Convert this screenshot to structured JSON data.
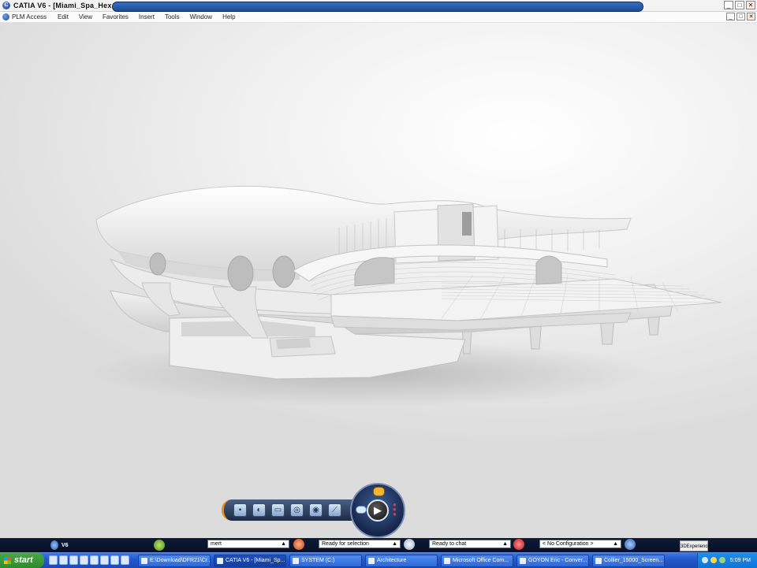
{
  "window": {
    "title": "CATIA V6 - [Miami_Spa_Hex --- IN_WORK]",
    "minimize_glyph": "_",
    "maximize_glyph": "□",
    "close_glyph": "✕"
  },
  "menu": {
    "items": [
      "PLM Access",
      "Edit",
      "View",
      "Favorites",
      "Insert",
      "Tools",
      "Window",
      "Help"
    ]
  },
  "toolbar": {
    "tools": [
      "filter-icon",
      "shading-icon",
      "view-icon",
      "render-icon",
      "camera-icon",
      "measure-icon"
    ]
  },
  "compass": {
    "play_glyph": "▶"
  },
  "status": {
    "v6_label": "V6",
    "command_value": "mert",
    "selection_status": "Ready for selection",
    "chat_status": "Ready to chat",
    "configuration": "< No Configuration >",
    "tray_label": "3DExperience"
  },
  "taskbar": {
    "start_label": "start",
    "tasks": [
      "E:\\Download\\DFR21\\Cr...",
      "CATIA V6 - [Miami_Sp...",
      "SYSTEM (C:)",
      "Architecture",
      "Microsoft Office Com...",
      "GOYON Eric - Conver...",
      "Collier_15000_Screen..."
    ],
    "clock": "5:09 PM"
  },
  "colors": {
    "accent_orange": "#e7901f",
    "status_blue": "#1c4a93",
    "taskbar_blue": "#2459cc"
  }
}
